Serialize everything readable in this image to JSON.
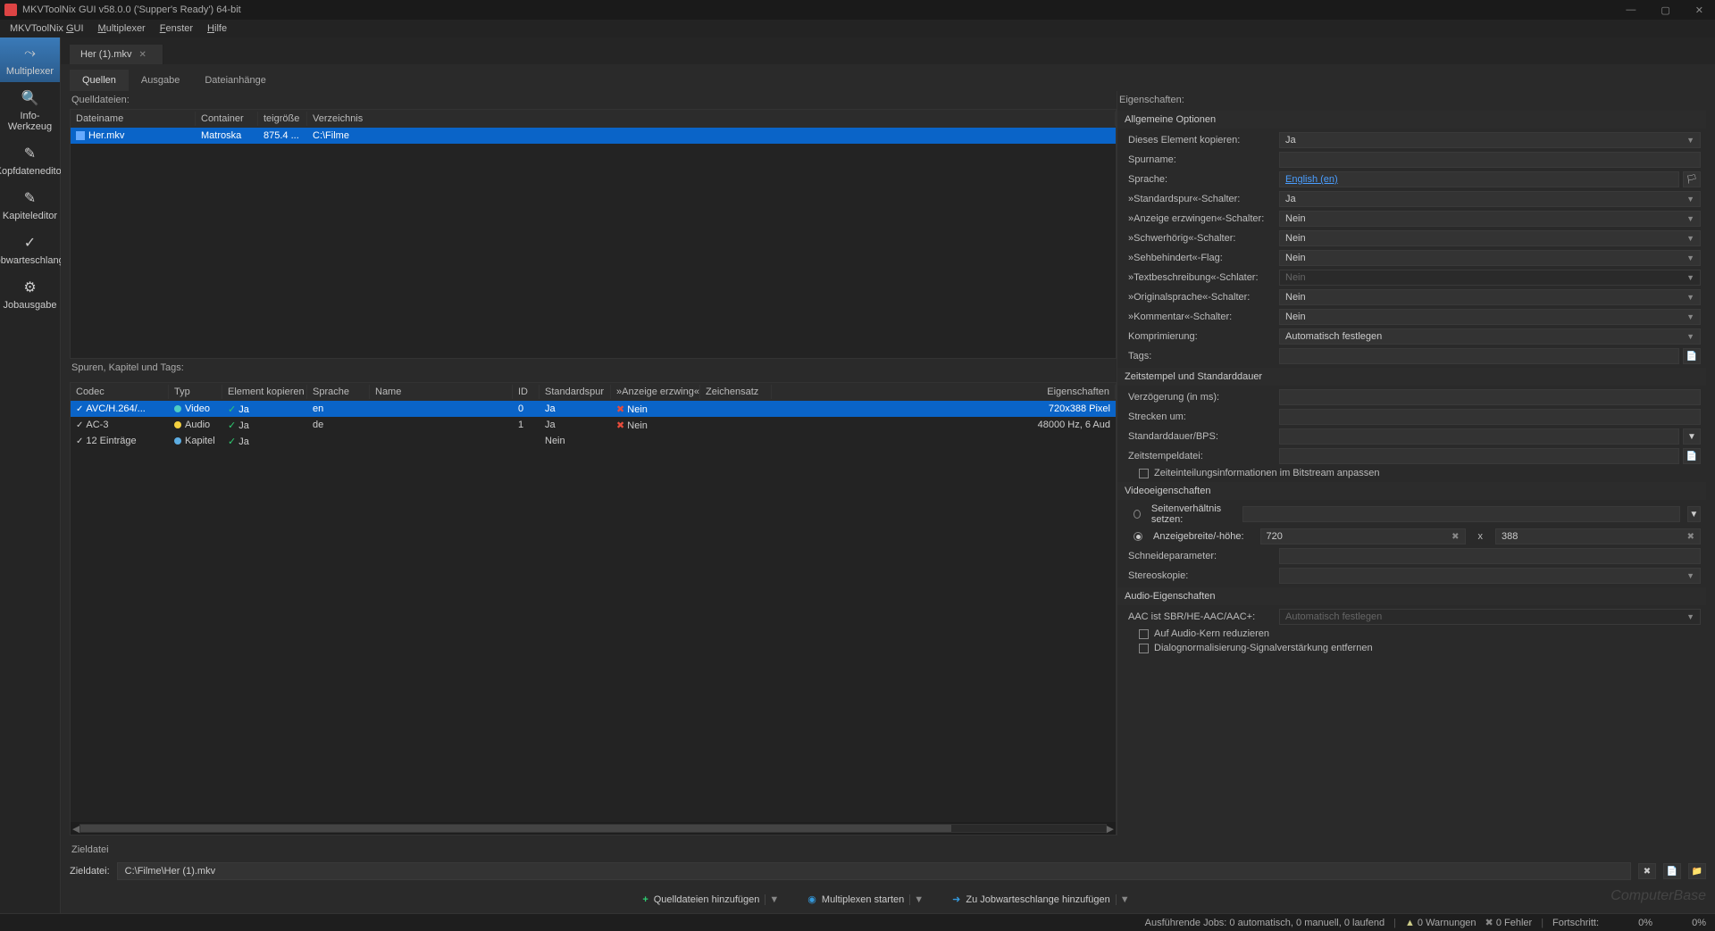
{
  "window": {
    "title": "MKVToolNix GUI v58.0.0 ('Supper's Ready') 64-bit"
  },
  "menubar": {
    "items": [
      "MKVToolNix GUI",
      "Multiplexer",
      "Fenster",
      "Hilfe"
    ]
  },
  "sidebar": {
    "items": [
      {
        "label": "Multiplexer",
        "icon": "⤳"
      },
      {
        "label": "Info-Werkzeug",
        "icon": "🔍"
      },
      {
        "label": "Kopfdateneditor",
        "icon": "✎"
      },
      {
        "label": "Kapiteleditor",
        "icon": "✎"
      },
      {
        "label": "Jobwarteschlange",
        "icon": "✓"
      },
      {
        "label": "Jobausgabe",
        "icon": "⚙"
      }
    ]
  },
  "fileTab": {
    "name": "Her (1).mkv"
  },
  "subTabs": {
    "items": [
      "Quellen",
      "Ausgabe",
      "Dateianhänge"
    ]
  },
  "sourceFiles": {
    "label": "Quelldateien:",
    "headers": {
      "filename": "Dateiname",
      "container": "Container",
      "size": "teigröße",
      "directory": "Verzeichnis"
    },
    "rows": [
      {
        "filename": "Her.mkv",
        "container": "Matroska",
        "size": "875.4 ...",
        "directory": "C:\\Filme"
      }
    ]
  },
  "tracks": {
    "label": "Spuren, Kapitel und Tags:",
    "headers": {
      "codec": "Codec",
      "type": "Typ",
      "copy": "Element kopieren",
      "lang": "Sprache",
      "name": "Name",
      "id": "ID",
      "default": "Standardspur",
      "forced": "»Anzeige erzwing«",
      "charset": "Zeichensatz",
      "props": "Eigenschaften"
    },
    "rows": [
      {
        "codec": "AVC/H.264/...",
        "type": "Video",
        "typeClass": "dot-video",
        "copy": "Ja",
        "lang": "en",
        "name": "",
        "id": "0",
        "default": "Ja",
        "forced": "Nein",
        "forcedNo": true,
        "props": "720x388 Pixel",
        "selected": true
      },
      {
        "codec": "AC-3",
        "type": "Audio",
        "typeClass": "dot-audio",
        "copy": "Ja",
        "lang": "de",
        "name": "",
        "id": "1",
        "default": "Ja",
        "forced": "Nein",
        "forcedNo": true,
        "props": "48000 Hz, 6 Aud"
      },
      {
        "codec": "12 Einträge",
        "type": "Kapitel",
        "typeClass": "dot-chapter",
        "copy": "Ja",
        "lang": "",
        "name": "",
        "id": "",
        "default": "Nein",
        "forced": "",
        "props": ""
      }
    ]
  },
  "properties": {
    "label": "Eigenschaften:",
    "sections": {
      "general": {
        "title": "Allgemeine Optionen",
        "copyElement": {
          "label": "Dieses Element kopieren:",
          "value": "Ja"
        },
        "trackName": {
          "label": "Spurname:",
          "value": ""
        },
        "language": {
          "label": "Sprache:",
          "value": "English (en)"
        },
        "defaultSwitch": {
          "label": "»Standardspur«-Schalter:",
          "value": "Ja"
        },
        "forcedSwitch": {
          "label": "»Anzeige erzwingen«-Schalter:",
          "value": "Nein"
        },
        "hearingImpaired": {
          "label": "»Schwerhörig«-Schalter:",
          "value": "Nein"
        },
        "visualImpaired": {
          "label": "»Sehbehindert«-Flag:",
          "value": "Nein"
        },
        "textDesc": {
          "label": "»Textbeschreibung«-Schlater:",
          "value": "Nein"
        },
        "origLang": {
          "label": "»Originalsprache«-Schalter:",
          "value": "Nein"
        },
        "commentary": {
          "label": "»Kommentar«-Schalter:",
          "value": "Nein"
        },
        "compression": {
          "label": "Komprimierung:",
          "value": "Automatisch festlegen"
        },
        "tags": {
          "label": "Tags:",
          "value": ""
        }
      },
      "timestamps": {
        "title": "Zeitstempel und Standarddauer",
        "delay": {
          "label": "Verzögerung (in ms):",
          "value": ""
        },
        "stretch": {
          "label": "Strecken um:",
          "value": ""
        },
        "defaultDuration": {
          "label": "Standarddauer/BPS:",
          "value": ""
        },
        "timestampFile": {
          "label": "Zeitstempeldatei:",
          "value": ""
        },
        "bitstreamTiming": {
          "label": "Zeiteinteilungsinformationen im Bitstream anpassen"
        }
      },
      "video": {
        "title": "Videoeigenschaften",
        "aspectRatio": {
          "label": "Seitenverhältnis setzen:"
        },
        "displayDims": {
          "label": "Anzeigebreite/-höhe:",
          "width": "720",
          "height": "388"
        },
        "cropping": {
          "label": "Schneideparameter:",
          "value": ""
        },
        "stereoscopy": {
          "label": "Stereoskopie:",
          "value": ""
        }
      },
      "audio": {
        "title": "Audio-Eigenschaften",
        "aacSbr": {
          "label": "AAC ist SBR/HE-AAC/AAC+:",
          "value": "Automatisch festlegen"
        },
        "reduceCore": {
          "label": "Auf Audio-Kern reduzieren"
        },
        "removeDialog": {
          "label": "Dialognormalisierung-Signalverstärkung entfernen"
        }
      }
    }
  },
  "destination": {
    "sectionLabel": "Zieldatei",
    "label": "Zieldatei:",
    "value": "C:\\Filme\\Her (1).mkv"
  },
  "actions": {
    "addSource": "Quelldateien hinzufügen",
    "startMux": "Multiplexen starten",
    "addQueue": "Zu Jobwarteschlange hinzufügen"
  },
  "statusbar": {
    "jobs": "Ausführende Jobs: 0 automatisch, 0 manuell, 0 laufend",
    "warnings": "0 Warnungen",
    "errors": "0 Fehler",
    "progress": "Fortschritt:",
    "pct1": "0%",
    "pct2": "0%"
  },
  "watermark": "ComputerBase",
  "x_sep": "x"
}
